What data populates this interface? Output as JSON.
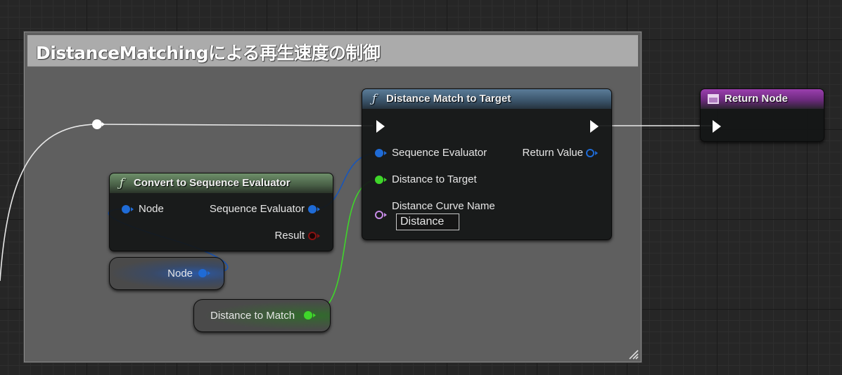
{
  "comment": {
    "title": "DistanceMatchingによる再生速度の制御"
  },
  "nodes": {
    "distance_match": {
      "title": "Distance Match to Target",
      "func_icon": "ƒ",
      "inputs": {
        "sequence_evaluator": "Sequence Evaluator",
        "distance_to_target": "Distance to Target",
        "distance_curve_name": "Distance Curve Name"
      },
      "outputs": {
        "return_value": "Return Value"
      },
      "curve_name_value": "Distance"
    },
    "convert": {
      "title": "Convert to Sequence Evaluator",
      "func_icon": "ƒ",
      "inputs": {
        "node": "Node"
      },
      "outputs": {
        "sequence_evaluator": "Sequence Evaluator",
        "result": "Result"
      }
    },
    "return_node": {
      "title": "Return Node"
    },
    "node_var": {
      "label": "Node"
    },
    "distance_to_match_var": {
      "label": "Distance to Match"
    }
  },
  "colors": {
    "struct_pin": "#1f6bd6",
    "float_pin": "#3fd62a",
    "name_pin": "#c68be6",
    "bool_pin": "#6a0e0e",
    "exec_wire": "#e8e8e8"
  },
  "icons": {
    "function": "function-icon",
    "return": "return-node-icon",
    "exec": "exec-pin-icon",
    "reroute": "reroute-knot-icon"
  }
}
